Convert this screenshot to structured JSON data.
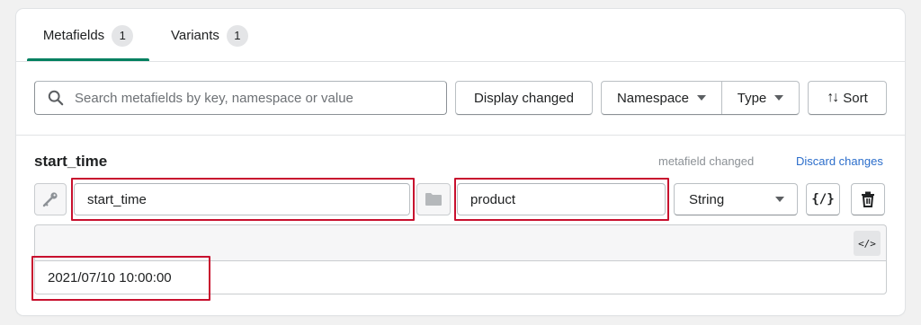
{
  "tabs": [
    {
      "label": "Metafields",
      "count": "1",
      "active": true
    },
    {
      "label": "Variants",
      "count": "1",
      "active": false
    }
  ],
  "toolbar": {
    "search_placeholder": "Search metafields by key, namespace or value",
    "display_changed_label": "Display changed",
    "namespace_label": "Namespace",
    "type_label": "Type",
    "sort_label": "Sort"
  },
  "metafield": {
    "title": "start_time",
    "status": "metafield changed",
    "discard_label": "Discard changes",
    "key_value": "start_time",
    "namespace_value": "product",
    "type_value": "String",
    "json_button_label": "{/}",
    "code_toggle_label": "</>",
    "value": "2021/07/10 10:00:00"
  },
  "colors": {
    "accent": "#008060",
    "link": "#2c6ecb",
    "highlight": "#c8102e"
  },
  "icons": [
    "search-icon",
    "chevron-down-icon",
    "sort-icon",
    "key-icon",
    "folder-icon",
    "trash-icon",
    "code-icon"
  ]
}
